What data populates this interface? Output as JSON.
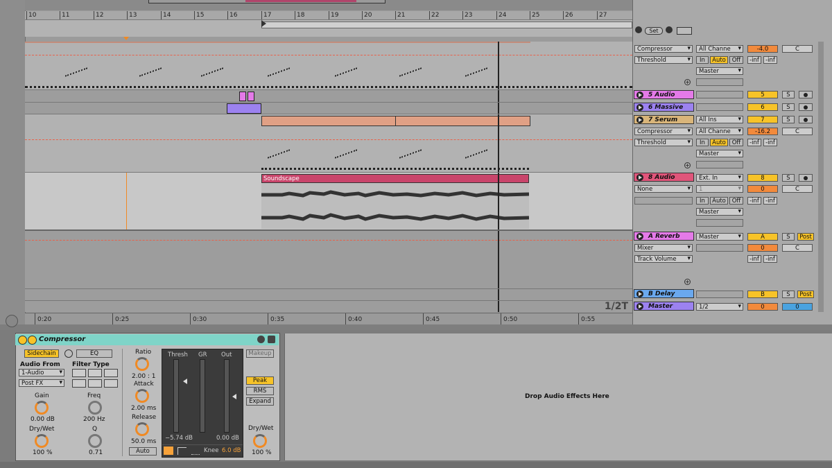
{
  "arrangement": {
    "bar_numbers": [
      "10",
      "11",
      "12",
      "13",
      "14",
      "15",
      "16",
      "17",
      "18",
      "19",
      "20",
      "21",
      "22",
      "23",
      "24",
      "25",
      "26",
      "27"
    ],
    "time_labels": [
      "0:20",
      "0:25",
      "0:30",
      "0:35",
      "0:40",
      "0:45",
      "0:50",
      "0:55"
    ],
    "set_button": "Set",
    "fraction_label": "1/2T",
    "clip_soundscape": "Soundscape"
  },
  "tracks": [
    {
      "id": "track4",
      "device": "Compressor",
      "param": "Threshold",
      "input": "All Channe",
      "in": "In",
      "auto": "Auto",
      "off": "Off",
      "volume": "-4.0",
      "pan": "C",
      "send1": "-inf",
      "send2": "-inf",
      "output": "Master"
    },
    {
      "id": "track5",
      "name": "5 Audio",
      "number": "5",
      "solo": "S",
      "color": "#e47ae8"
    },
    {
      "id": "track6",
      "name": "6 Massive",
      "number": "6",
      "solo": "S",
      "color": "#9c82f0"
    },
    {
      "id": "track7",
      "name": "7 Serum",
      "number": "7",
      "solo": "S",
      "device": "Compressor",
      "param": "Threshold",
      "input_type": "All Ins",
      "input": "All Channe",
      "volume": "-16.2",
      "pan": "C",
      "in": "In",
      "auto": "Auto",
      "off": "Off",
      "send1": "-inf",
      "send2": "-inf",
      "output": "Master",
      "color": "#d9b57a"
    },
    {
      "id": "track8",
      "name": "8 Audio",
      "number": "8",
      "solo": "S",
      "device": "None",
      "input_type": "Ext. In",
      "input": "1",
      "volume": "0",
      "pan": "C",
      "in": "In",
      "auto": "Auto",
      "off": "Off",
      "send1": "-inf",
      "send2": "-inf",
      "output": "Master",
      "color": "#e0557a"
    },
    {
      "id": "reverb",
      "name": "A Reverb",
      "number": "A",
      "solo": "S",
      "post": "Post",
      "device": "Mixer",
      "param": "Track Volume",
      "output": "Master",
      "volume": "0",
      "pan": "C",
      "send1": "-inf",
      "send2": "-inf",
      "color": "#e47ae8"
    },
    {
      "id": "delay",
      "name": "B Delay",
      "number": "B",
      "solo": "S",
      "post": "Post",
      "color": "#6aa8ee"
    },
    {
      "id": "master",
      "name": "Master",
      "output": "1/2",
      "volume": "0",
      "cue": "0",
      "color": "#9c82f0"
    }
  ],
  "compressor": {
    "title": "Compressor",
    "sidechain": "Sidechain",
    "eq": "EQ",
    "audio_from_label": "Audio From",
    "audio_from": "1-Audio",
    "audio_from_pos": "Post FX",
    "filter_type_label": "Filter Type",
    "gain_label": "Gain",
    "gain_value": "0.00 dB",
    "freq_label": "Freq",
    "freq_value": "200 Hz",
    "drywet_sc_label": "Dry/Wet",
    "drywet_sc_value": "100 %",
    "q_label": "Q",
    "q_value": "0.71",
    "ratio_label": "Ratio",
    "ratio_value": "2.00 : 1",
    "attack_label": "Attack",
    "attack_value": "2.00 ms",
    "release_label": "Release",
    "release_value": "50.0 ms",
    "auto_label": "Auto",
    "thresh_label": "Thresh",
    "gr_label": "GR",
    "out_label": "Out",
    "thresh_value": "−5.74 dB",
    "out_value": "0.00 dB",
    "knee_label": "Knee",
    "knee_value": "6.0 dB",
    "makeup": "Makeup",
    "peak": "Peak",
    "rms": "RMS",
    "expand": "Expand",
    "drywet_label": "Dry/Wet",
    "drywet_value": "100 %"
  },
  "dropzone_text": "Drop Audio Effects Here"
}
